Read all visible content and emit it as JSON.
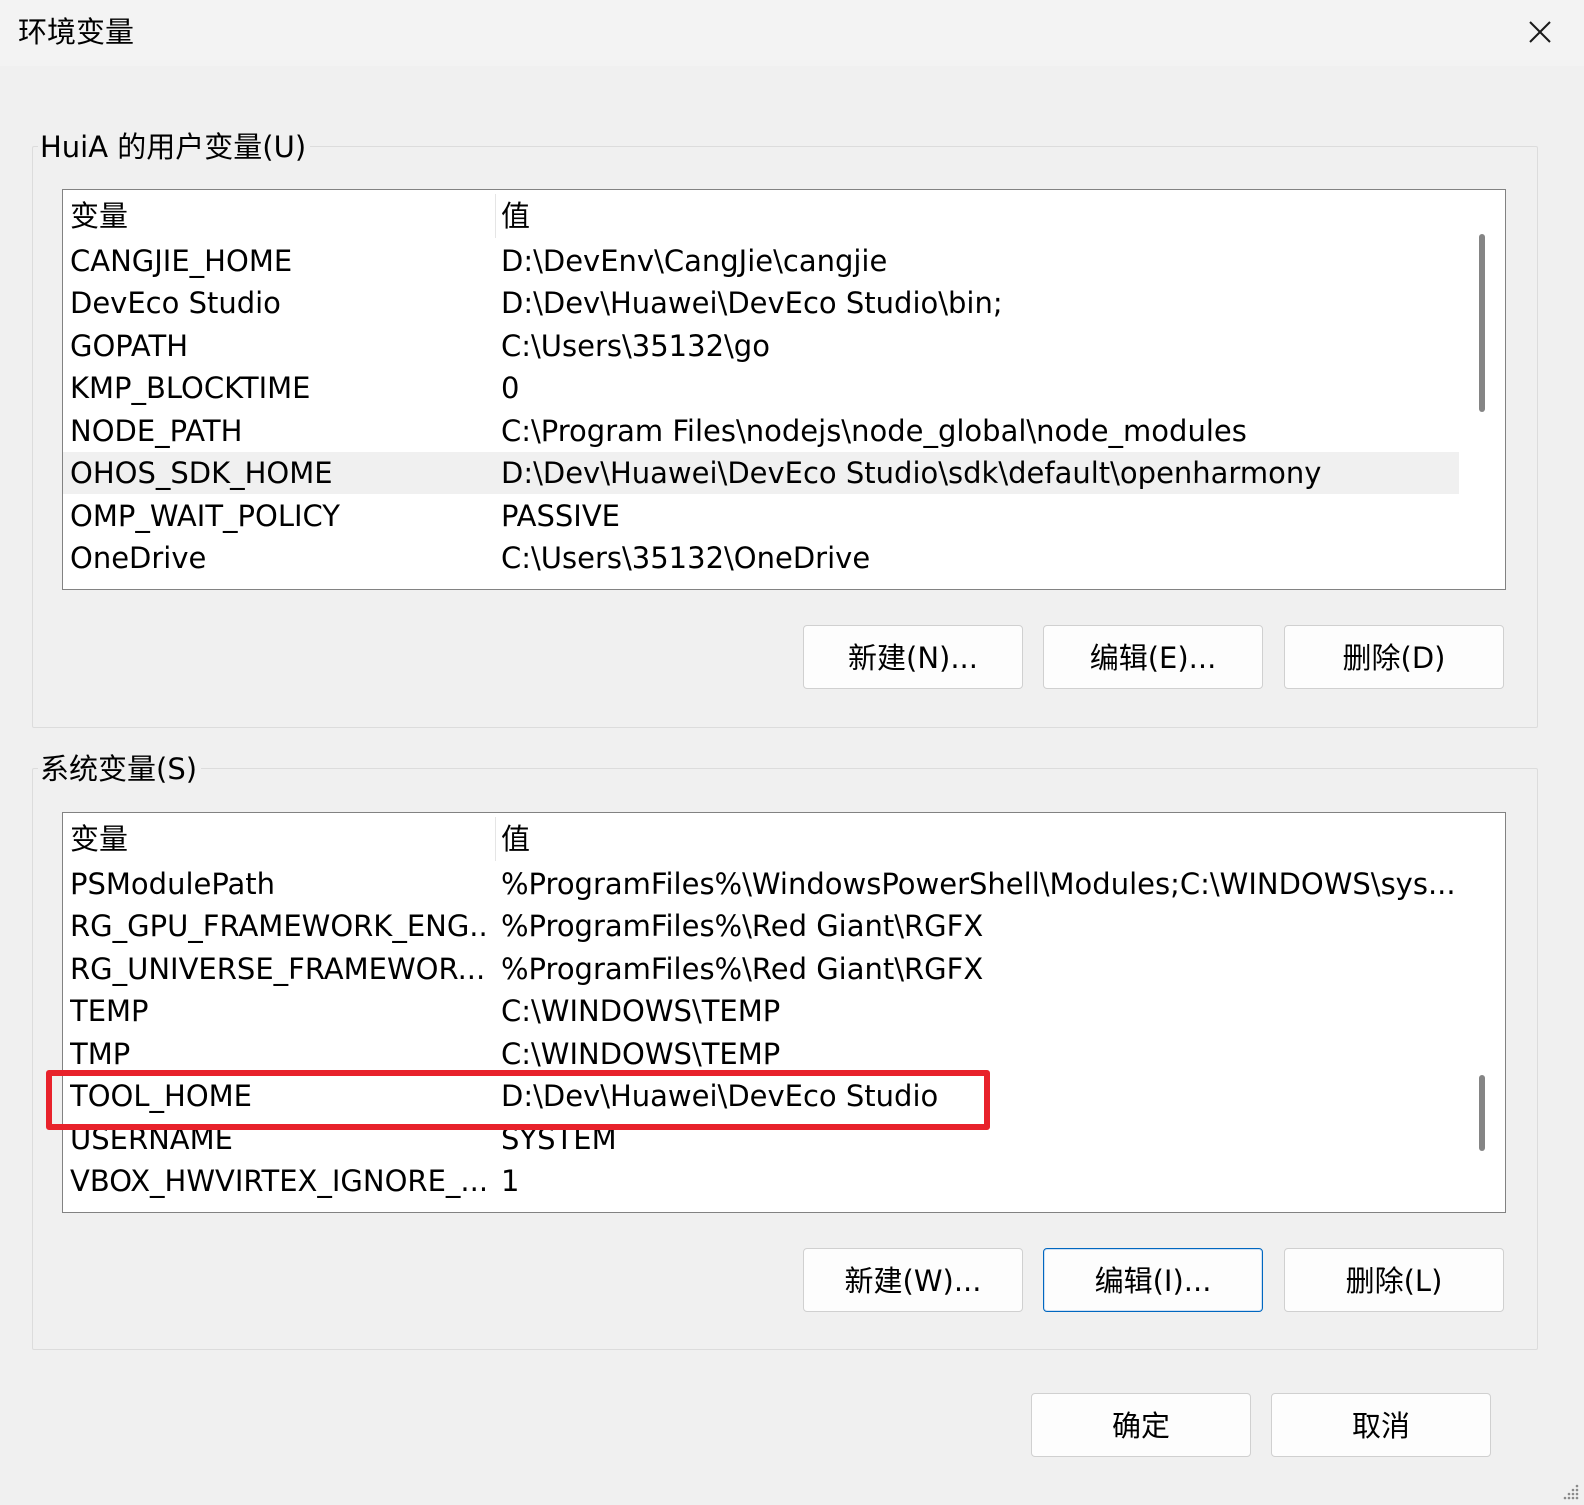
{
  "window": {
    "title": "环境变量"
  },
  "user_vars": {
    "legend": "HuiA 的用户变量(U)",
    "columns": [
      "变量",
      "值"
    ],
    "rows": [
      {
        "name": "CANGJIE_HOME",
        "value": "D:\\DevEnv\\CangJie\\cangjie"
      },
      {
        "name": "DevEco Studio",
        "value": "D:\\Dev\\Huawei\\DevEco Studio\\bin;"
      },
      {
        "name": "GOPATH",
        "value": "C:\\Users\\35132\\go"
      },
      {
        "name": "KMP_BLOCKTIME",
        "value": "0"
      },
      {
        "name": "NODE_PATH",
        "value": "C:\\Program Files\\nodejs\\node_global\\node_modules"
      },
      {
        "name": "OHOS_SDK_HOME",
        "value": "D:\\Dev\\Huawei\\DevEco Studio\\sdk\\default\\openharmony"
      },
      {
        "name": "OMP_WAIT_POLICY",
        "value": "PASSIVE"
      },
      {
        "name": "OneDrive",
        "value": "C:\\Users\\35132\\OneDrive"
      }
    ],
    "buttons": {
      "new": "新建(N)...",
      "edit": "编辑(E)...",
      "delete": "删除(D)"
    }
  },
  "system_vars": {
    "legend": "系统变量(S)",
    "columns": [
      "变量",
      "值"
    ],
    "rows": [
      {
        "name": "PSModulePath",
        "value": "%ProgramFiles%\\WindowsPowerShell\\Modules;C:\\WINDOWS\\sys..."
      },
      {
        "name": "RG_GPU_FRAMEWORK_ENG...",
        "value": "%ProgramFiles%\\Red Giant\\RGFX"
      },
      {
        "name": "RG_UNIVERSE_FRAMEWOR...",
        "value": "%ProgramFiles%\\Red Giant\\RGFX"
      },
      {
        "name": "TEMP",
        "value": "C:\\WINDOWS\\TEMP"
      },
      {
        "name": "TMP",
        "value": "C:\\WINDOWS\\TEMP"
      },
      {
        "name": "TOOL_HOME",
        "value": "D:\\Dev\\Huawei\\DevEco Studio"
      },
      {
        "name": "USERNAME",
        "value": "SYSTEM"
      },
      {
        "name": "VBOX_HWVIRTEX_IGNORE_...",
        "value": "1"
      }
    ],
    "buttons": {
      "new": "新建(W)...",
      "edit": "编辑(I)...",
      "delete": "删除(L)"
    }
  },
  "footer": {
    "ok": "确定",
    "cancel": "取消"
  },
  "colors": {
    "highlight": "#e8222b",
    "focus_border": "#0067c0",
    "selected_row": "#f0f0f0"
  },
  "icons": [
    "close-icon",
    "resize-grip-icon"
  ]
}
